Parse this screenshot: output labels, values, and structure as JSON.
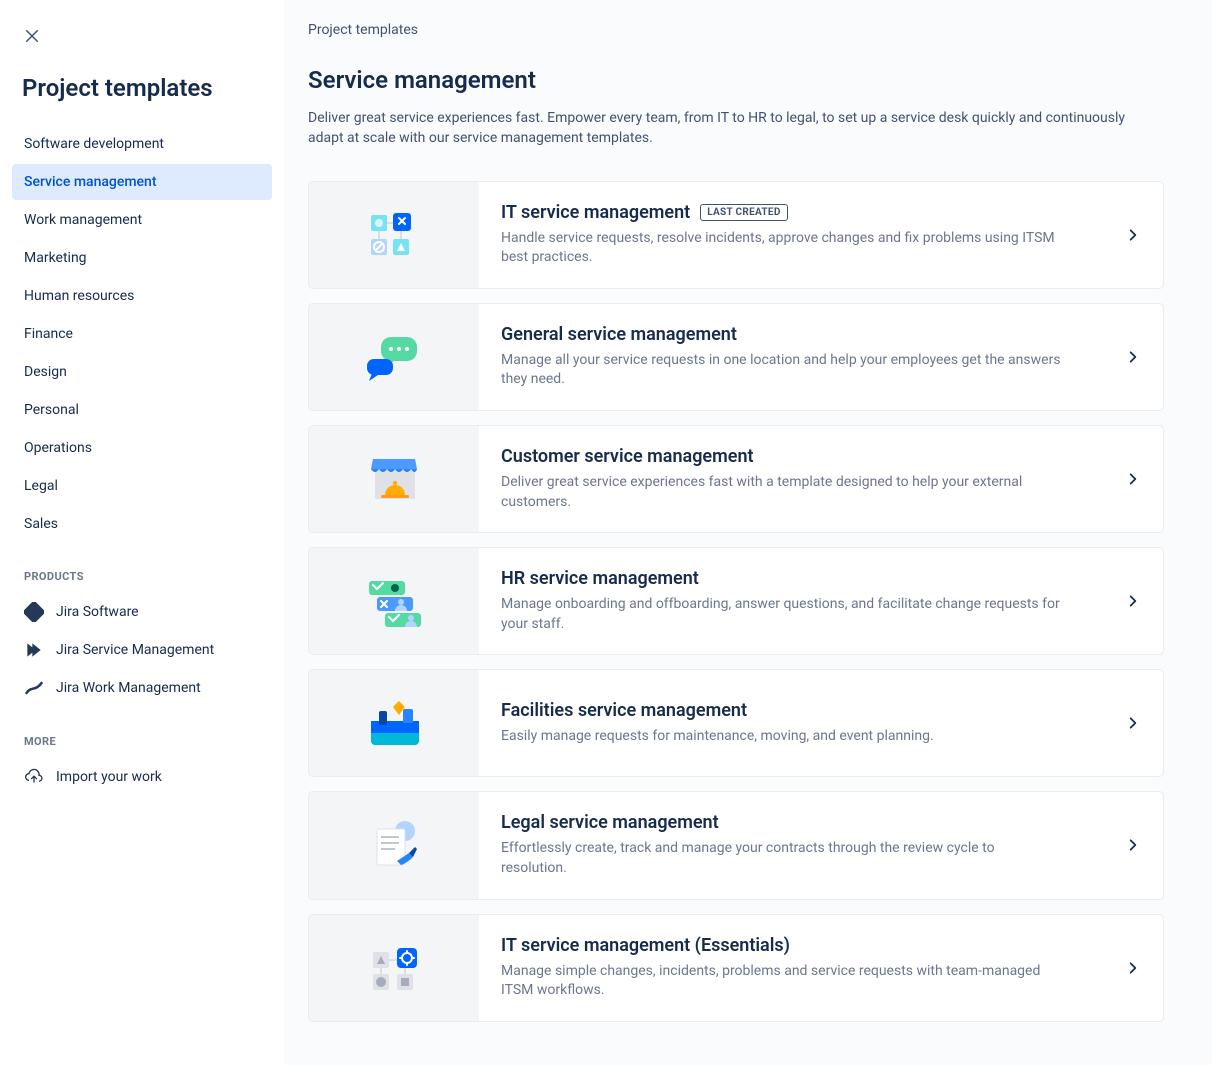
{
  "sidebar": {
    "title": "Project templates",
    "categories": [
      "Software development",
      "Service management",
      "Work management",
      "Marketing",
      "Human resources",
      "Finance",
      "Design",
      "Personal",
      "Operations",
      "Legal",
      "Sales"
    ],
    "activeIndex": 1,
    "productsLabel": "PRODUCTS",
    "products": [
      "Jira Software",
      "Jira Service Management",
      "Jira Work Management"
    ],
    "moreLabel": "MORE",
    "moreItems": [
      "Import your work"
    ]
  },
  "main": {
    "breadcrumb": "Project templates",
    "title": "Service management",
    "description": "Deliver great service experiences fast. Empower every team, from IT to HR to legal, to set up a service desk quickly and continuously adapt at scale with our service management templates.",
    "templates": [
      {
        "title": "IT service management",
        "badge": "LAST CREATED",
        "description": "Handle service requests, resolve incidents, approve changes and fix problems using ITSM best practices."
      },
      {
        "title": "General service management",
        "badge": null,
        "description": "Manage all your service requests in one location and help your employees get the answers they need."
      },
      {
        "title": "Customer service management",
        "badge": null,
        "description": "Deliver great service experiences fast with a template designed to help your external customers."
      },
      {
        "title": "HR service management",
        "badge": null,
        "description": "Manage onboarding and offboarding, answer questions, and facilitate change requests for your staff."
      },
      {
        "title": "Facilities service management",
        "badge": null,
        "description": "Easily manage requests for maintenance, moving, and event planning."
      },
      {
        "title": "Legal service management",
        "badge": null,
        "description": "Effortlessly create, track and manage your contracts through the review cycle to resolution."
      },
      {
        "title": "IT service management (Essentials)",
        "badge": null,
        "description": "Manage simple changes, incidents, problems and service requests with team-managed ITSM workflows."
      }
    ]
  }
}
